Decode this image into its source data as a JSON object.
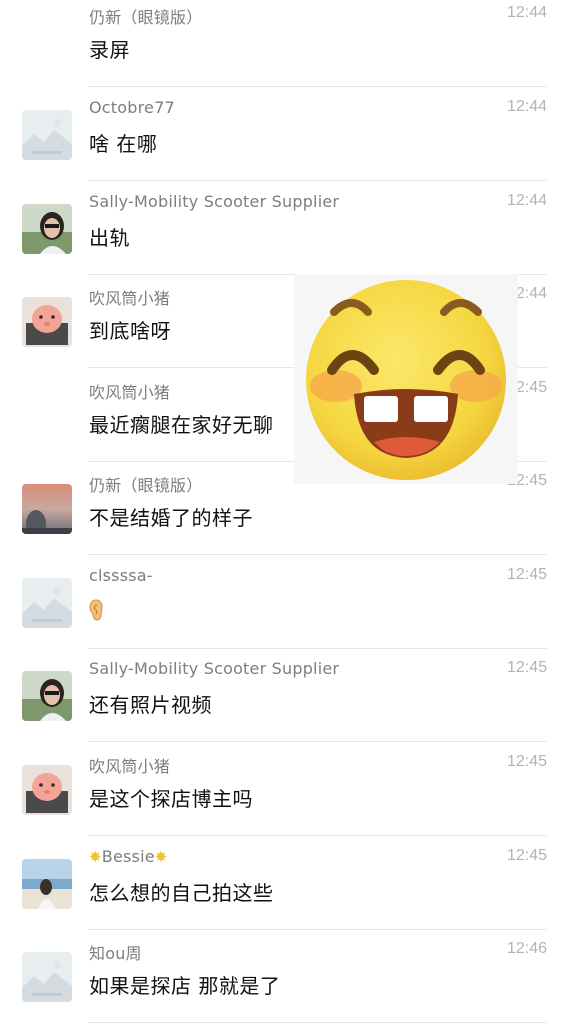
{
  "messages": [
    {
      "name": "仍新（眼镜版）",
      "time": "12:44",
      "text": "录屏",
      "avatar": "none"
    },
    {
      "name": "Octobre77",
      "time": "12:44",
      "text": "啥 在哪",
      "avatar": "placeholder-avatar"
    },
    {
      "name": "Sally-Mobility Scooter Supplier",
      "time": "12:44",
      "text": "出轨",
      "avatar": "woman-sunglasses-avatar"
    },
    {
      "name": "吹风筒小猪",
      "time": "12:44",
      "text": "到底啥呀",
      "avatar": "pink-pig-avatar"
    },
    {
      "name": "吹风筒小猪",
      "time": "12:45",
      "text": "最近瘸腿在家好无聊",
      "avatar": "none"
    },
    {
      "name": "仍新（眼镜版）",
      "time": "12:45",
      "text": "不是结婚了的样子",
      "avatar": "sunset-photo-avatar"
    },
    {
      "name": "clssssa-",
      "time": "12:45",
      "text": "",
      "avatar": "placeholder-avatar",
      "emoji": "ear-icon"
    },
    {
      "name": "Sally-Mobility Scooter Supplier",
      "time": "12:45",
      "text": "还有照片视频",
      "avatar": "woman-sunglasses-avatar"
    },
    {
      "name": "吹风筒小猪",
      "time": "12:45",
      "text": "是这个探店博主吗",
      "avatar": "pink-pig-avatar"
    },
    {
      "name": "Bessie",
      "time": "12:45",
      "text": "怎么想的自己拍这些",
      "avatar": "beach-photo-avatar",
      "name_decoration": "star-icon"
    },
    {
      "name": "知ou周",
      "time": "12:46",
      "text": "如果是探店 那就是了",
      "avatar": "placeholder-avatar"
    }
  ],
  "overlay": {
    "icon": "grinning-face-sticker-icon"
  },
  "colors": {
    "background": "#ffffff",
    "name_text": "#7d7d7d",
    "time_text": "#b3b3b3",
    "message_text": "#111111",
    "divider": "#e6e6e6",
    "sticker_yellow": "#f5d640"
  }
}
